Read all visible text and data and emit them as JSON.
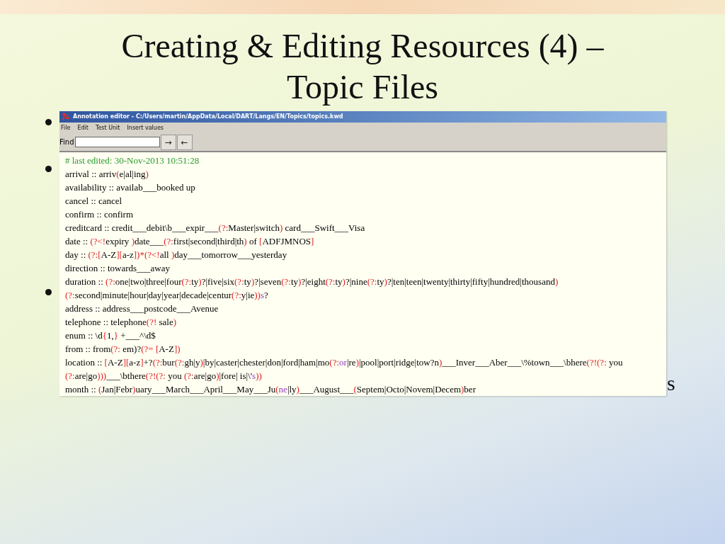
{
  "slide": {
    "title_lines": [
      "Creating & Editing Resources (4) –",
      "Topic Files"
    ],
    "bullet_fragment": "s"
  },
  "window": {
    "title": "Annotation editor - C:/Users/martin/AppData/Local/DART/Langs/EN/Topics/topics.kwd",
    "menu": [
      "File",
      "Edit",
      "Test Unit",
      "Insert values"
    ],
    "find": {
      "label": "Find",
      "buttons": [
        "→",
        "←"
      ]
    },
    "lines": [
      {
        "segments": [
          {
            "text": "# last edited: 30-Nov-2013 10:51:28",
            "kind": "comment"
          }
        ]
      },
      {
        "segments": [
          {
            "text": "arrival :: arriv",
            "kind": "plain"
          },
          {
            "text": "(",
            "kind": "group"
          },
          {
            "text": "e|al|ing",
            "kind": "plain"
          },
          {
            "text": ")",
            "kind": "group"
          }
        ]
      },
      {
        "segments": [
          {
            "text": "availability :: availab___booked up",
            "kind": "plain"
          }
        ]
      },
      {
        "segments": [
          {
            "text": "cancel :: cancel",
            "kind": "plain"
          }
        ]
      },
      {
        "segments": [
          {
            "text": "confirm :: confirm",
            "kind": "plain"
          }
        ]
      },
      {
        "segments": [
          {
            "text": "creditcard :: credit___debit\\b___expir___",
            "kind": "plain"
          },
          {
            "text": "(?:",
            "kind": "group"
          },
          {
            "text": "Master|switch",
            "kind": "plain"
          },
          {
            "text": ")",
            "kind": "group"
          },
          {
            "text": " card___Swift___Visa",
            "kind": "plain"
          }
        ]
      },
      {
        "segments": [
          {
            "text": "date :: ",
            "kind": "plain"
          },
          {
            "text": "(?<!",
            "kind": "group"
          },
          {
            "text": "expiry ",
            "kind": "plain"
          },
          {
            "text": ")",
            "kind": "group"
          },
          {
            "text": "date___",
            "kind": "plain"
          },
          {
            "text": "(?:",
            "kind": "group"
          },
          {
            "text": "first|second|third|th",
            "kind": "plain"
          },
          {
            "text": ")",
            "kind": "group"
          },
          {
            "text": " of ",
            "kind": "plain"
          },
          {
            "text": "[",
            "kind": "group"
          },
          {
            "text": "ADFJMNOS",
            "kind": "plain"
          },
          {
            "text": "]",
            "kind": "group"
          }
        ]
      },
      {
        "segments": [
          {
            "text": "day :: ",
            "kind": "plain"
          },
          {
            "text": "(?:[",
            "kind": "group"
          },
          {
            "text": "A-Z",
            "kind": "plain"
          },
          {
            "text": "][",
            "kind": "group"
          },
          {
            "text": "a-z",
            "kind": "plain"
          },
          {
            "text": "])*(?<!",
            "kind": "group"
          },
          {
            "text": "all ",
            "kind": "plain"
          },
          {
            "text": ")",
            "kind": "group"
          },
          {
            "text": "day___tomorrow___yesterday",
            "kind": "plain"
          }
        ]
      },
      {
        "segments": [
          {
            "text": "direction :: towards___away",
            "kind": "plain"
          }
        ]
      },
      {
        "segments": [
          {
            "text": "duration :: ",
            "kind": "plain"
          },
          {
            "text": "(?:",
            "kind": "group"
          },
          {
            "text": "one|two|three|four",
            "kind": "plain"
          },
          {
            "text": "(?:",
            "kind": "group"
          },
          {
            "text": "ty",
            "kind": "plain"
          },
          {
            "text": ")",
            "kind": "group"
          },
          {
            "text": "?|five|six",
            "kind": "plain"
          },
          {
            "text": "(?:",
            "kind": "group"
          },
          {
            "text": "ty",
            "kind": "plain"
          },
          {
            "text": ")",
            "kind": "group"
          },
          {
            "text": "?|seven",
            "kind": "plain"
          },
          {
            "text": "(?:",
            "kind": "group"
          },
          {
            "text": "ty",
            "kind": "plain"
          },
          {
            "text": ")",
            "kind": "group"
          },
          {
            "text": "?|eight",
            "kind": "plain"
          },
          {
            "text": "(?:",
            "kind": "group"
          },
          {
            "text": "ty",
            "kind": "plain"
          },
          {
            "text": ")",
            "kind": "group"
          },
          {
            "text": "?|nine",
            "kind": "plain"
          },
          {
            "text": "(?:",
            "kind": "group"
          },
          {
            "text": "ty",
            "kind": "plain"
          },
          {
            "text": ")",
            "kind": "group"
          },
          {
            "text": "?|ten|teen|twenty|thirty|fifty|hundred|thousand",
            "kind": "plain"
          },
          {
            "text": ")",
            "kind": "group"
          }
        ],
        "continuation": [
          {
            "text": "(?:",
            "kind": "group"
          },
          {
            "text": "second|minute|hour|day|year|decade|centur",
            "kind": "plain"
          },
          {
            "text": "(?:",
            "kind": "group"
          },
          {
            "text": "y|ie",
            "kind": "plain"
          },
          {
            "text": "))",
            "kind": "group"
          },
          {
            "text": "s",
            "kind": "marker"
          },
          {
            "text": "?",
            "kind": "plain"
          }
        ]
      },
      {
        "segments": [
          {
            "text": "address :: address___postcode___Avenue",
            "kind": "plain"
          }
        ]
      },
      {
        "segments": [
          {
            "text": "telephone :: telephone",
            "kind": "plain"
          },
          {
            "text": "(?!",
            "kind": "group"
          },
          {
            "text": " sale",
            "kind": "plain"
          },
          {
            "text": ")",
            "kind": "group"
          }
        ]
      },
      {
        "segments": [
          {
            "text": "enum :: \\d",
            "kind": "plain"
          },
          {
            "text": "{",
            "kind": "group"
          },
          {
            "text": "1,",
            "kind": "plain"
          },
          {
            "text": "}",
            "kind": "group"
          },
          {
            "text": " +___^\\d$",
            "kind": "plain"
          }
        ]
      },
      {
        "segments": [
          {
            "text": "from :: from",
            "kind": "plain"
          },
          {
            "text": "(?:",
            "kind": "group"
          },
          {
            "text": " em)?",
            "kind": "plain"
          },
          {
            "text": "(?= [",
            "kind": "group"
          },
          {
            "text": "A-Z",
            "kind": "plain"
          },
          {
            "text": "])",
            "kind": "group"
          }
        ]
      },
      {
        "segments": [
          {
            "text": "location :: ",
            "kind": "plain"
          },
          {
            "text": "[",
            "kind": "group"
          },
          {
            "text": "A-Z",
            "kind": "plain"
          },
          {
            "text": "][",
            "kind": "group"
          },
          {
            "text": "a-z",
            "kind": "plain"
          },
          {
            "text": "]",
            "kind": "group"
          },
          {
            "text": "+?",
            "kind": "plain"
          },
          {
            "text": "(?:",
            "kind": "group"
          },
          {
            "text": "bur",
            "kind": "plain"
          },
          {
            "text": "(?:",
            "kind": "group"
          },
          {
            "text": "gh|y",
            "kind": "plain"
          },
          {
            "text": ")",
            "kind": "group"
          },
          {
            "text": "|by|caster|chester|don|ford|ham|mo",
            "kind": "plain"
          },
          {
            "text": "(?:",
            "kind": "group"
          },
          {
            "text": "or",
            "kind": "marker"
          },
          {
            "text": "|re",
            "kind": "plain"
          },
          {
            "text": ")",
            "kind": "group"
          },
          {
            "text": "|pool|port|ridge|tow?n",
            "kind": "plain"
          },
          {
            "text": ")",
            "kind": "group"
          },
          {
            "text": "___Inver___Aber___\\%town___\\bhere",
            "kind": "plain"
          },
          {
            "text": "(?!(?:",
            "kind": "group"
          },
          {
            "text": " you",
            "kind": "plain"
          }
        ],
        "continuation": [
          {
            "text": "(?:",
            "kind": "group"
          },
          {
            "text": "are|go",
            "kind": "plain"
          },
          {
            "text": ")))",
            "kind": "group"
          },
          {
            "text": "___\\bthere",
            "kind": "plain"
          },
          {
            "text": "(?!(?:",
            "kind": "group"
          },
          {
            "text": " you ",
            "kind": "plain"
          },
          {
            "text": "(?:",
            "kind": "group"
          },
          {
            "text": "are|go",
            "kind": "plain"
          },
          {
            "text": ")",
            "kind": "group"
          },
          {
            "text": "|fore| is|\\'",
            "kind": "plain"
          },
          {
            "text": "s",
            "kind": "marker"
          },
          {
            "text": "))",
            "kind": "group"
          }
        ]
      },
      {
        "segments": [
          {
            "text": "month :: ",
            "kind": "plain"
          },
          {
            "text": "(",
            "kind": "group"
          },
          {
            "text": "Jan|Febr",
            "kind": "plain"
          },
          {
            "text": ")",
            "kind": "group"
          },
          {
            "text": "uary___March___April___May___Ju",
            "kind": "plain"
          },
          {
            "text": "(",
            "kind": "group"
          },
          {
            "text": "ne",
            "kind": "marker"
          },
          {
            "text": "|ly",
            "kind": "plain"
          },
          {
            "text": ")",
            "kind": "group"
          },
          {
            "text": "___August___",
            "kind": "plain"
          },
          {
            "text": "(",
            "kind": "group"
          },
          {
            "text": "Septem|Octo|Novem|Decem",
            "kind": "plain"
          },
          {
            "text": ")",
            "kind": "group"
          },
          {
            "text": "ber",
            "kind": "plain"
          }
        ]
      }
    ]
  }
}
